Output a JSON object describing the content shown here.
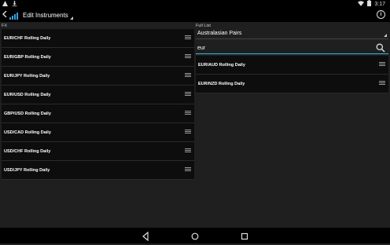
{
  "status_bar": {
    "time": "3:17",
    "warning_icon": "warning-icon",
    "download_icon": "download-icon"
  },
  "action_bar": {
    "title": "Edit Instruments"
  },
  "left_panel": {
    "label": "FX",
    "items": [
      {
        "label": "EUR/CHF Rolling Daily"
      },
      {
        "label": "EUR/GBP Rolling Daily"
      },
      {
        "label": "EUR/JPY Rolling Daily"
      },
      {
        "label": "EUR/USD Rolling Daily"
      },
      {
        "label": "GBP/USD Rolling Daily"
      },
      {
        "label": "USD/CAD Rolling Daily"
      },
      {
        "label": "USD/CHF Rolling Daily"
      },
      {
        "label": "USD/JPY Rolling Daily"
      }
    ]
  },
  "right_panel": {
    "label": "Full List",
    "dropdown": {
      "selected": "Australasian Pairs"
    },
    "search": {
      "value": "eur"
    },
    "items": [
      {
        "label": "EUR/AUD Rolling Daily"
      },
      {
        "label": "EUR/NZD Rolling Daily"
      }
    ]
  },
  "colors": {
    "accent": "#33b5e5",
    "row_bg": "#0d0d0d",
    "page_bg": "#1f1f1f"
  }
}
